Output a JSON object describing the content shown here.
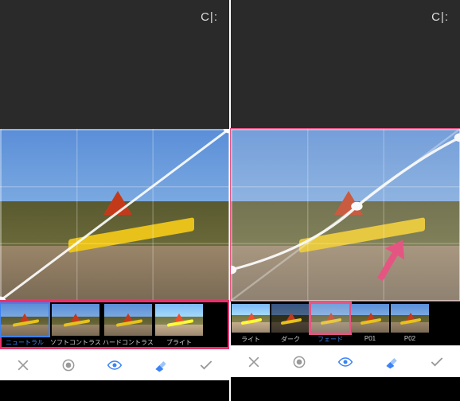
{
  "compare_icon_label": "C|:",
  "left": {
    "curve_type": "linear",
    "presets": [
      {
        "label": "ニュートラル",
        "active": true
      },
      {
        "label": "ソフトコントラスト",
        "active": false
      },
      {
        "label": "ハードコントラスト",
        "active": false
      },
      {
        "label": "ブライト",
        "active": false
      }
    ]
  },
  "right": {
    "curve_type": "fade",
    "highlighted": true,
    "presets": [
      {
        "label": "ライト",
        "active": false
      },
      {
        "label": "ダーク",
        "active": false
      },
      {
        "label": "フェード",
        "active": true,
        "highlighted": true
      },
      {
        "label": "P01",
        "active": false
      },
      {
        "label": "P02",
        "active": false
      }
    ]
  },
  "toolbar": {
    "close": "✕",
    "accept": "✓"
  }
}
